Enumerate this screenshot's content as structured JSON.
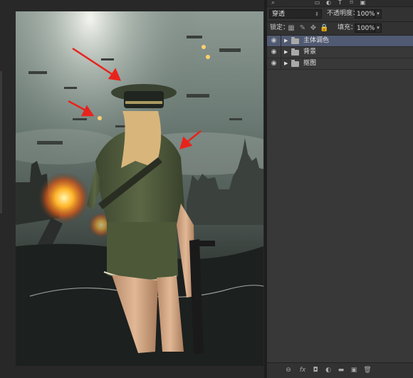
{
  "layers_panel": {
    "blend_mode": "穿透",
    "opacity_label": "不透明度：",
    "opacity_value": "100%",
    "lock_label": "锁定：",
    "fill_label": "填充：",
    "fill_value": "100%",
    "layers": [
      {
        "name": "主体调色",
        "type": "group",
        "visible": true,
        "selected": true
      },
      {
        "name": "背景",
        "type": "group",
        "visible": true,
        "selected": false
      },
      {
        "name": "抠图",
        "type": "group",
        "visible": true,
        "selected": false
      }
    ],
    "bottom_icons": [
      "link-icon",
      "fx-icon",
      "mask-icon",
      "adjustment-icon",
      "group-icon",
      "new-layer-icon",
      "trash-icon"
    ],
    "bottom_icon_glyphs": [
      "⊖",
      "fx",
      "◘",
      "◐",
      "▬",
      "▣",
      "🗑"
    ]
  },
  "colors": {
    "panel_bg": "#3a3a3a",
    "selected_layer": "#505a72",
    "annotation_arrow": "#e8231c"
  }
}
